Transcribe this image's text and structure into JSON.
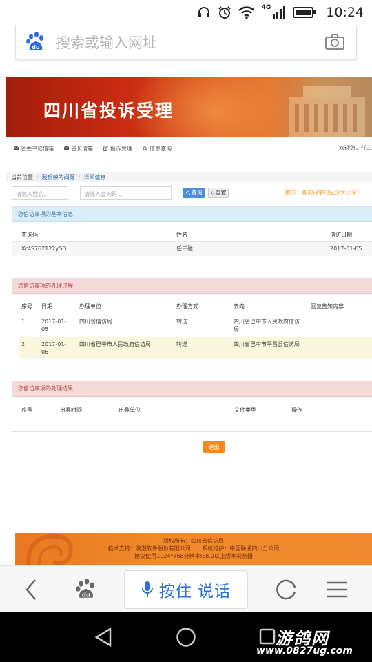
{
  "status_bar": {
    "time": "10:24",
    "network": "4G"
  },
  "browser": {
    "search_placeholder": "搜索或输入网址",
    "voice_label": "按住 说话"
  },
  "banner": {
    "title": "四川省投诉受理"
  },
  "nav": {
    "items": [
      {
        "label": "省委书记信箱",
        "icon": "mail-icon"
      },
      {
        "label": "省长信箱",
        "icon": "mail-icon"
      },
      {
        "label": "投诉受理",
        "icon": "edit-icon"
      },
      {
        "label": "信息查询",
        "icon": "search-icon"
      }
    ],
    "welcome": "欢迎您，任三"
  },
  "breadcrumb": {
    "current": "当前位置",
    "my": "我反映的问题",
    "detail": "详细信息"
  },
  "filter": {
    "name_placeholder": "请输入姓名...",
    "code_placeholder": "请输入查询码...",
    "query_label": "查询",
    "reset_label": "重置",
    "hint": "提示：查询码字母区分大小写！"
  },
  "basic_info": {
    "title": "您信访事项的基本信息",
    "headers": [
      "查询码",
      "姓名",
      "信访日期"
    ],
    "row": [
      "Xr4S762122ySO",
      "任三碰",
      "2017-01-05"
    ]
  },
  "process": {
    "title": "您信访事项的办理过程",
    "headers": [
      "序号",
      "日期",
      "办理单位",
      "办理方式",
      "去向",
      "回复告知内容"
    ],
    "rows": [
      [
        "1",
        "2017-01-\n05",
        "四川省信访局",
        "转送",
        "四川省巴中市人民政府信访\n局",
        ""
      ],
      [
        "2",
        "2017-01-\n06",
        "四川省巴中市人民政府信访局",
        "转送",
        "四川省巴中市平昌县信访局",
        ""
      ]
    ]
  },
  "result": {
    "title": "您信访事项的处理结果",
    "headers": [
      "序号",
      "出具时间",
      "出具单位",
      "文件类型",
      "操作"
    ]
  },
  "exit_label": "退出",
  "footer": {
    "line1": "版权所有：四川省信访局",
    "line2_a": "技术支持：浪潮软件股份有限公司",
    "line2_b": "系统维护：中国联通四川分公司",
    "line3": "建议使用1024*768分辨率IE8.0以上版本浏览器"
  },
  "watermark": {
    "title": "游鸽网",
    "url": "www.0827ug.com"
  },
  "colors": {
    "banner": "#c72a10",
    "accent_blue": "#4a8fdd",
    "footer": "#f08a2a",
    "voice": "#2b73d6"
  }
}
